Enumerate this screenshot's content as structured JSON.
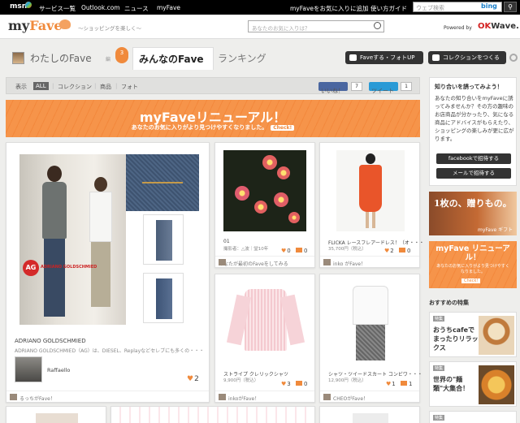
{
  "topnav": {
    "msn": "msn",
    "links": [
      "サービス一覧",
      "Outlook.com",
      "ニュース",
      "myFave"
    ],
    "add_favorite": "myFaveをお気に入りに追加",
    "guide": "使い方ガイド",
    "websearch_placeholder": "ウェブ検索",
    "bing": "bing"
  },
  "header": {
    "logo_main": "my",
    "logo_accent": "Fave",
    "tagline": "〜ショッピングを楽しく〜",
    "search_placeholder": "あなたのお気に入りは？",
    "powered_by": "Powered by",
    "okwave_ok": "OK",
    "okwave_rest": "Wave."
  },
  "tabs": {
    "my": "わたしのFave",
    "edit": "編",
    "count": "3",
    "all": "みんなのFave",
    "ranking": "ランキング",
    "fave_photo_btn": "Faveする・フォトUP",
    "collection_btn": "コレクションをつくる"
  },
  "filters": {
    "label": "表示",
    "all": "ALL",
    "collection": "コレクション",
    "product": "商品",
    "photo": "フォト",
    "like": "いいね！",
    "like_count": "7",
    "tweet": "ツイート",
    "tweet_count": "1"
  },
  "banner": {
    "title": "myFaveリニューアル！",
    "subtitle": "あなたのお気に入りがより見つけやすくなりました。",
    "check": "Check!"
  },
  "cards": {
    "big": {
      "brand_logo": "AG",
      "brand_logo_text": "ADRIANO GOLDSCHMIED",
      "title": "ADRIANO GOLDSCHMIED",
      "desc": "ADRIANO GOLDSCHMIED（AG）は、DIESEL、Replayなどセレブにも多くの・・・",
      "user": "Raffaello",
      "faves": "2",
      "footer": "るっちがFave！"
    },
    "flowers": {
      "title": "01",
      "price": "撮影者：△波｜堂10年",
      "faves": "0",
      "comments": "0",
      "footer": "あなたが最初のFaveをしてみる"
    },
    "dress": {
      "title": "FLICKA レースフレアードレス！（オ・・・",
      "price": "35,700円（税込）",
      "faves": "2",
      "comments": "0",
      "footer": "inko がFave！"
    },
    "shirt": {
      "title": "ストライプ クレリックシャツ",
      "price": "9,900円（税込）",
      "faves": "3",
      "comments": "0",
      "footer": "inkoがFave！"
    },
    "skirt": {
      "title": "シャツ・ツイードスカート コンビワ・・・",
      "price": "12,900円（税込）",
      "faves": "1",
      "comments": "1",
      "footer": "CHEOがFave！"
    }
  },
  "sidebar": {
    "invite_title": "知り合いを誘ってみよう！",
    "invite_text": "あなたの知り合いをmyFaveに誘ってみませんか？その方の趣味のお店商品が分かったり、気になる商品にアドバイスがもらえたり、ショッピングの楽しみが更に広がります。",
    "facebook_btn": "facebookで招待する",
    "mail_btn": "メールで招待する",
    "ad1": "1枚の、贈りもの。",
    "ad1_sub": "myFave ギフト",
    "ad2_title": "myFave リニューアル！",
    "ad2_sub": "あなたのお気に入りがより見つけやすくなりました。",
    "ad2_check": "Check!",
    "recommend": "おすすめの特集",
    "feat_tag": "特集",
    "feat1": "おうちcafeでまったりリラックス",
    "feat2": "世界の\"麺類\"大集合！",
    "feat3": "特集"
  }
}
